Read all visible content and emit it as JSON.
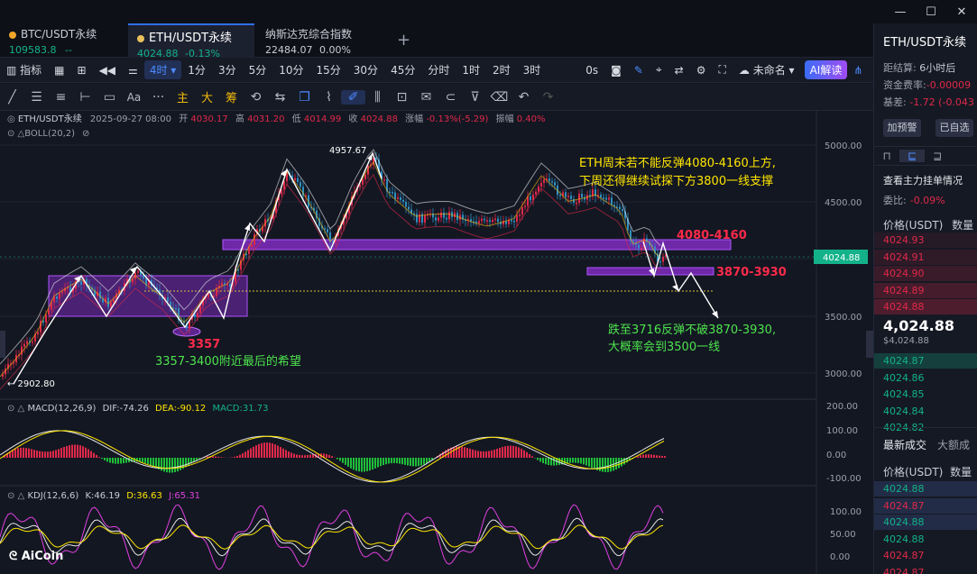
{
  "tabs": [
    {
      "symbol": "BTC/USDT永续",
      "price": "109583.8",
      "change": "--",
      "active": false
    },
    {
      "symbol": "ETH/USDT永续",
      "price": "4024.88",
      "change": "-0.13%",
      "active": true
    },
    {
      "symbol": "纳斯达克综合指数",
      "price": "22484.07",
      "change": "0.00%",
      "active": false
    }
  ],
  "tab_add": "+",
  "win_controls": [
    "—",
    "☐",
    "✕"
  ],
  "toolbar1": {
    "indicator": "指标",
    "interval_active": "4时",
    "intervals": [
      "1分",
      "3分",
      "5分",
      "10分",
      "15分",
      "30分",
      "45分",
      "分时",
      "1时",
      "2时",
      "3时"
    ],
    "seconds": "0s",
    "layout_name": "未命名",
    "ai_button": "AI解读"
  },
  "toolbar2": {
    "labels": [
      "主",
      "大",
      "筹"
    ]
  },
  "infobar": {
    "symbol": "ETH/USDT永续",
    "datetime": "2025-09-27 08:00",
    "open_l": "开",
    "open": "4030.17",
    "high_l": "高",
    "high": "4031.20",
    "low_l": "低",
    "low": "4014.99",
    "close_l": "收",
    "close": "4024.88",
    "chg_l": "涨幅",
    "chg": "-0.13%(-5.29)",
    "amp_l": "振幅",
    "amp": "0.40%"
  },
  "boll_label": "BOLL(20,2)",
  "macd": {
    "label": "MACD(12,26,9)",
    "dif": "DIF:-74.26",
    "dea": "DEA:-90.12",
    "macd": "MACD:31.73"
  },
  "kdj": {
    "label": "KDJ(12,6,6)",
    "k": "K:46.19",
    "d": "D:36.63",
    "j": "J:65.31"
  },
  "price_axis": [
    "5000.00",
    "4500.00",
    "4000.00",
    "3500.00",
    "3000.00"
  ],
  "macd_axis": [
    "200.00",
    "100.00",
    "0.00",
    "-100.00"
  ],
  "kdj_axis": [
    "100.00",
    "50.00",
    "0.00"
  ],
  "current_price_tag": "4024.88",
  "annotations": {
    "high_label": "4957.67",
    "low_label": "← 2902.80",
    "label_3357": "3357",
    "note_3357": "3357-3400附近最后的希望",
    "top_note_1": "ETH周末若不能反弹4080-4160上方,",
    "top_note_2": "下周还得继续试探下方3800一线支撑",
    "zone1": "4080-4160",
    "zone2": "3870-3930",
    "note_bottom_1": "跌至3716反弹不破3870-3930,",
    "note_bottom_2": "大概率会到3500一线"
  },
  "watermark": "AiCoin",
  "right_panel": {
    "symbol": "ETH/USDT永续",
    "settle_l": "距结算:",
    "settle": "6小时后",
    "funding_l": "资金费率:",
    "funding": "-0.00009",
    "basis_l": "基差:",
    "basis": "-1.72 (-0.043",
    "btn_alert": "加预警",
    "btn_selected": "已自选",
    "orderbook_title": "查看主力挂单情况",
    "ratio_l": "委比:",
    "ratio": "-0.09%",
    "col_price": "价格(USDT)",
    "col_qty": "数量",
    "asks": [
      "4024.93",
      "4024.91",
      "4024.90",
      "4024.89",
      "4024.88"
    ],
    "last": "4,024.88",
    "last_sub": "$4,024.88",
    "bids": [
      "4024.87",
      "4024.86",
      "4024.85",
      "4024.84",
      "4024.82"
    ],
    "trades_tab": "最新成交",
    "trades_tab2": "大额成",
    "trades_col_price": "价格(USDT)",
    "trades_col_qty": "数量",
    "trades": [
      "4024.88",
      "4024.87",
      "4024.88",
      "4024.88",
      "4024.87",
      "4024.87"
    ]
  },
  "colors": {
    "up": "#e0294a",
    "down": "#13b28a",
    "bg": "#131722",
    "purple": "#8e2fd6",
    "annot_yellow": "#ffe600",
    "annot_green": "#4de34d",
    "accent": "#2f6fea"
  },
  "chart_data": {
    "type": "candlestick",
    "symbol": "ETH/USDT永续",
    "interval": "4时",
    "y_axis": [
      3000,
      3500,
      4000,
      4500,
      5000
    ],
    "high": 4957.67,
    "low": 2902.8,
    "last": 4024.88
  }
}
